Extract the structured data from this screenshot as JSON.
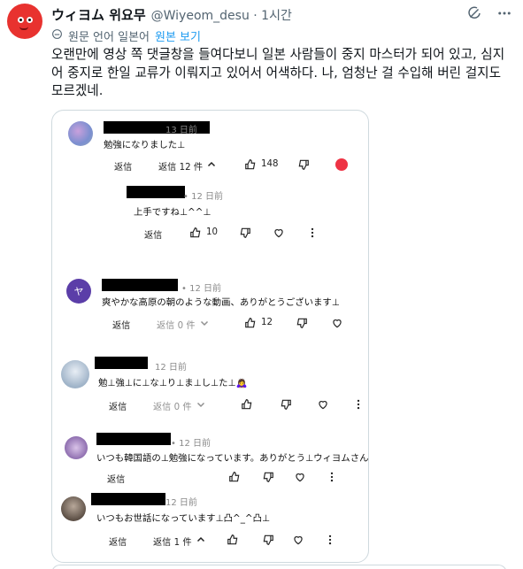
{
  "tweet": {
    "display_name": "ウィヨム 위요무",
    "handle_time": "@Wiyeom_desu · 1시간",
    "translate_label": "원문 언어 일본어",
    "translate_link": "원본 보기",
    "text": "오랜만에 영상 쪽 댓글창을 들여다보니 일본 사람들이 중지 마스터가 되어 있고, 심지어 중지로 한일 교류가 이뤄지고 있어서 어색하다. 나, 엄청난 걸 수입해 버린 걸지도 모르겠네."
  },
  "comments": [
    {
      "time": "13 日前",
      "text": "勉強になりました⊥",
      "reply_label": "返信",
      "replies_label": "返信 12 件",
      "likes": "148"
    },
    {
      "time": "• 12 日前",
      "text": "上手ですね⊥^^⊥",
      "reply_label": "返信",
      "likes": "10"
    },
    {
      "avatar_letter": "ヤ",
      "time": "• 12 日前",
      "text": "爽やかな高原の朝のような動画、ありがとうございます⊥",
      "reply_label": "返信",
      "replies_label": "返信 0 件",
      "likes": "12"
    },
    {
      "time": "12 日前",
      "text": "勉⊥強⊥に⊥な⊥り⊥ま⊥し⊥た⊥🙇‍♀️",
      "reply_label": "返信",
      "replies_label": "返信 0 件"
    },
    {
      "time": "• 12 日前",
      "text": "いつも韓国語の⊥勉強になっています。ありがとう⊥ウィヨムさん。",
      "reply_label": "返信"
    },
    {
      "time": "12 日前",
      "text": "いつもお世話になっています⊥凸^_^凸⊥",
      "reply_label": "返信",
      "replies_label": "返信 1 件"
    }
  ]
}
